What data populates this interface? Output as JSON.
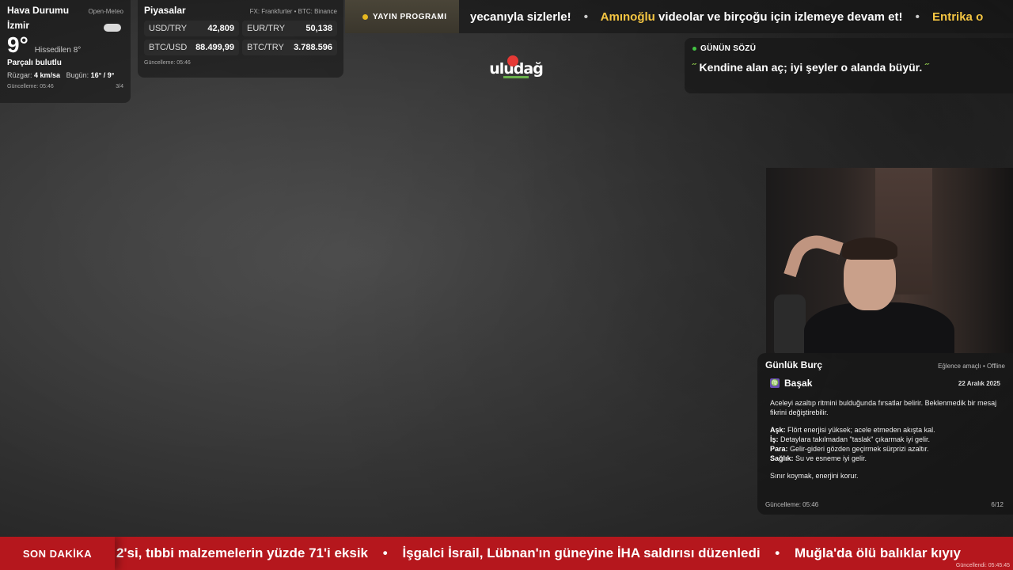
{
  "weather": {
    "title": "Hava Durumu",
    "source": "Open-Meteo",
    "city": "İzmir",
    "temp": "9°",
    "feels": "Hissedilen 8°",
    "condition": "Parçalı bulutlu",
    "wind_label": "Rüzgar:",
    "wind_value": "4 km/sa",
    "today_label": "Bugün:",
    "today_value": "16° / 9°",
    "updated": "Güncelleme: 05:46",
    "page": "3/4",
    "icon": "partly-cloudy-icon"
  },
  "markets": {
    "title": "Piyasalar",
    "source": "FX: Frankfurter • BTC: Binance",
    "rates": [
      {
        "pair": "USD/TRY",
        "value": "42,809"
      },
      {
        "pair": "EUR/TRY",
        "value": "50,138"
      },
      {
        "pair": "BTC/USD",
        "value": "88.499,99"
      },
      {
        "pair": "BTC/TRY",
        "value": "3.788.596"
      }
    ],
    "updated": "Güncelleme: 05:46"
  },
  "top_ticker": {
    "program_label": "YAYIN PROGRAMI",
    "part1": "yecanıyla sizlerle!",
    "highlight1": "Amınoğlu",
    "part2": " videolar ve birçoğu için izlemeye devam et!",
    "highlight2": "Entrika o",
    "separator": "•"
  },
  "logo": {
    "text": "uludağ"
  },
  "quote": {
    "title": "GÜNÜN SÖZÜ",
    "open_mark": "˝",
    "text": " Kendine alan aç; iyi şeyler o alanda büyür. ",
    "close_mark": "˝"
  },
  "horoscope": {
    "title": "Günlük Burç",
    "meta": "Eğlence amaçlı • Offline",
    "sign": "Başak",
    "sign_symbol": "♍",
    "date": "22 Aralık 2025",
    "intro": "Aceleyi azaltıp ritmini bulduğunda fırsatlar belirir. Beklenmedik bir mesaj fikrini değiştirebilir.",
    "items": [
      {
        "label": "Aşk:",
        "text": " Flört enerjisi yüksek; acele etmeden akışta kal."
      },
      {
        "label": "İş:",
        "text": " Detaylara takılmadan \"taslak\" çıkarmak iyi gelir."
      },
      {
        "label": "Para:",
        "text": " Gelir-gideri gözden geçirmek sürprizi azaltır."
      },
      {
        "label": "Sağlık:",
        "text": " Su ve esneme iyi gelir."
      }
    ],
    "closing": "Sınır koymak, enerjini korur.",
    "updated": "Güncelleme: 05:46",
    "page": "6/12"
  },
  "news": {
    "label": "SON DAKİKA",
    "item1": "2'si, tıbbi malzemelerin yüzde 71'i eksik",
    "item2": "İşgalci İsrail, Lübnan'ın güneyine İHA saldırısı düzenledi",
    "item3": "Muğla'da ölü balıklar kıyıy",
    "separator": "•",
    "stamp": "Güncellendi: 05:45:45"
  },
  "colors": {
    "news_bar": "#b5171d",
    "ticker_highlight": "#f4c542",
    "quote_accent": "#8bc34a",
    "program_dot": "#e6b820"
  }
}
